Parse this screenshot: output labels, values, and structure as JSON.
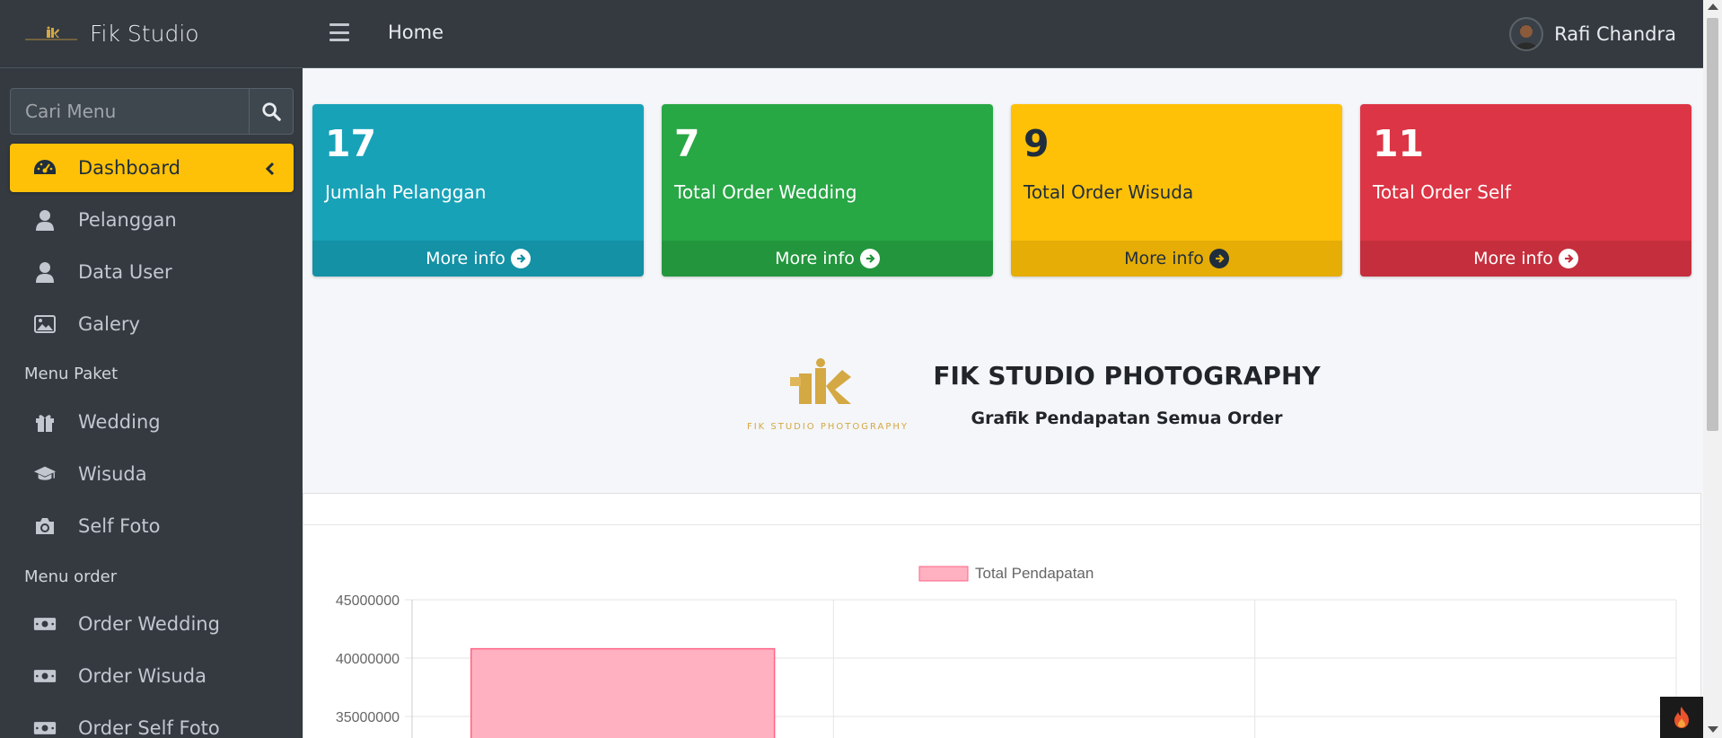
{
  "sidebar": {
    "brand": "Fik Studio",
    "search_placeholder": "Cari Menu",
    "items": [
      {
        "label": "Dashboard",
        "icon": "tachometer-icon",
        "active": true
      },
      {
        "label": "Pelanggan",
        "icon": "user-icon"
      },
      {
        "label": "Data User",
        "icon": "user-icon"
      },
      {
        "label": "Galery",
        "icon": "image-icon"
      }
    ],
    "header_paket": "Menu Paket",
    "paket_items": [
      {
        "label": "Wedding",
        "icon": "gift-icon"
      },
      {
        "label": "Wisuda",
        "icon": "graduation-cap-icon"
      },
      {
        "label": "Self Foto",
        "icon": "camera-icon"
      }
    ],
    "header_order": "Menu order",
    "order_items": [
      {
        "label": "Order Wedding",
        "icon": "money-bill-icon"
      },
      {
        "label": "Order Wisuda",
        "icon": "money-bill-icon"
      },
      {
        "label": "Order Self Foto",
        "icon": "money-bill-icon"
      }
    ]
  },
  "topbar": {
    "home": "Home",
    "user_name": "Rafi Chandra"
  },
  "stats": [
    {
      "value": "17",
      "label": "Jumlah Pelanggan",
      "link": "More info",
      "color": "#17a2b8"
    },
    {
      "value": "7",
      "label": "Total Order Wedding",
      "link": "More info",
      "color": "#28a745"
    },
    {
      "value": "9",
      "label": "Total Order Wisuda",
      "link": "More info",
      "color": "#ffc107"
    },
    {
      "value": "11",
      "label": "Total Order Self",
      "link": "More info",
      "color": "#dc3545"
    }
  ],
  "hero": {
    "title": "FIK STUDIO PHOTOGRAPHY",
    "subtitle": "Grafik Pendapatan Semua Order",
    "logo_text": "FIK STUDIO PHOTOGRAPHY"
  },
  "chart_data": {
    "type": "bar",
    "categories": [
      "",
      "",
      ""
    ],
    "series": [
      {
        "name": "Total Pendapatan",
        "values": [
          40800000,
          null,
          null
        ]
      }
    ],
    "ylim": [
      30000000,
      45000000
    ],
    "y_ticks": [
      "45000000",
      "40000000",
      "35000000"
    ],
    "colors": {
      "fill": "#ffb1c1",
      "stroke": "#ff6384"
    },
    "legend": "top-center",
    "grid": true
  }
}
